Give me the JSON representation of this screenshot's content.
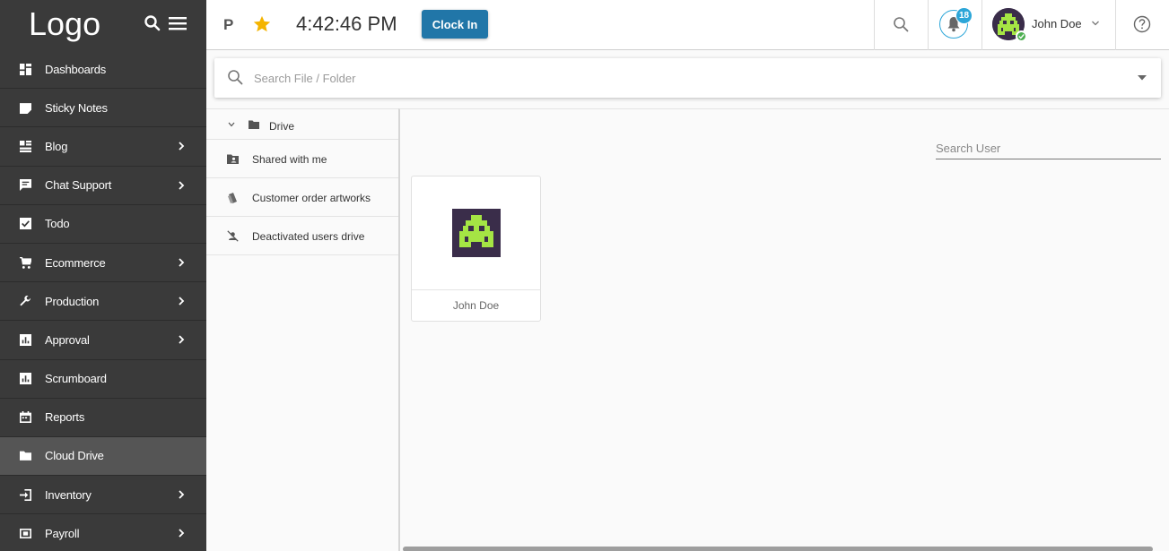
{
  "sidebar": {
    "logo": "Logo",
    "items": [
      {
        "label": "Dashboards",
        "icon": "dashboard-icon",
        "has_submenu": false,
        "active": false
      },
      {
        "label": "Sticky Notes",
        "icon": "sticky-note-icon",
        "has_submenu": false,
        "active": false
      },
      {
        "label": "Blog",
        "icon": "blog-icon",
        "has_submenu": true,
        "active": false
      },
      {
        "label": "Chat Support",
        "icon": "chat-icon",
        "has_submenu": true,
        "active": false
      },
      {
        "label": "Todo",
        "icon": "checkbox-icon",
        "has_submenu": false,
        "active": false
      },
      {
        "label": "Ecommerce",
        "icon": "cart-icon",
        "has_submenu": true,
        "active": false
      },
      {
        "label": "Production",
        "icon": "wrench-icon",
        "has_submenu": true,
        "active": false
      },
      {
        "label": "Approval",
        "icon": "chart-icon",
        "has_submenu": true,
        "active": false
      },
      {
        "label": "Scrumboard",
        "icon": "chart-icon",
        "has_submenu": false,
        "active": false
      },
      {
        "label": "Reports",
        "icon": "calendar-icon",
        "has_submenu": false,
        "active": false
      },
      {
        "label": "Cloud Drive",
        "icon": "folder-icon",
        "has_submenu": false,
        "active": true
      },
      {
        "label": "Inventory",
        "icon": "login-icon",
        "has_submenu": true,
        "active": false
      },
      {
        "label": "Payroll",
        "icon": "payroll-icon",
        "has_submenu": true,
        "active": false
      }
    ]
  },
  "topbar": {
    "p_label": "P",
    "time": "4:42:46 PM",
    "clock_in_label": "Clock In",
    "notification_count": "18",
    "user_name": "John Doe",
    "accent": "#2176a8",
    "badge_color": "#2ca6d8",
    "star_color": "#f4b400",
    "online_color": "#4caf50"
  },
  "file_search": {
    "placeholder": "Search File / Folder"
  },
  "tree": {
    "root_label": "Drive",
    "items": [
      {
        "label": "Shared with me",
        "icon": "shared-folder-icon"
      },
      {
        "label": "Customer order artworks",
        "icon": "artwork-icon"
      },
      {
        "label": "Deactivated users drive",
        "icon": "deactivated-user-icon"
      }
    ]
  },
  "panel": {
    "user_search_placeholder": "Search User",
    "users": [
      {
        "name": "John Doe"
      }
    ]
  }
}
